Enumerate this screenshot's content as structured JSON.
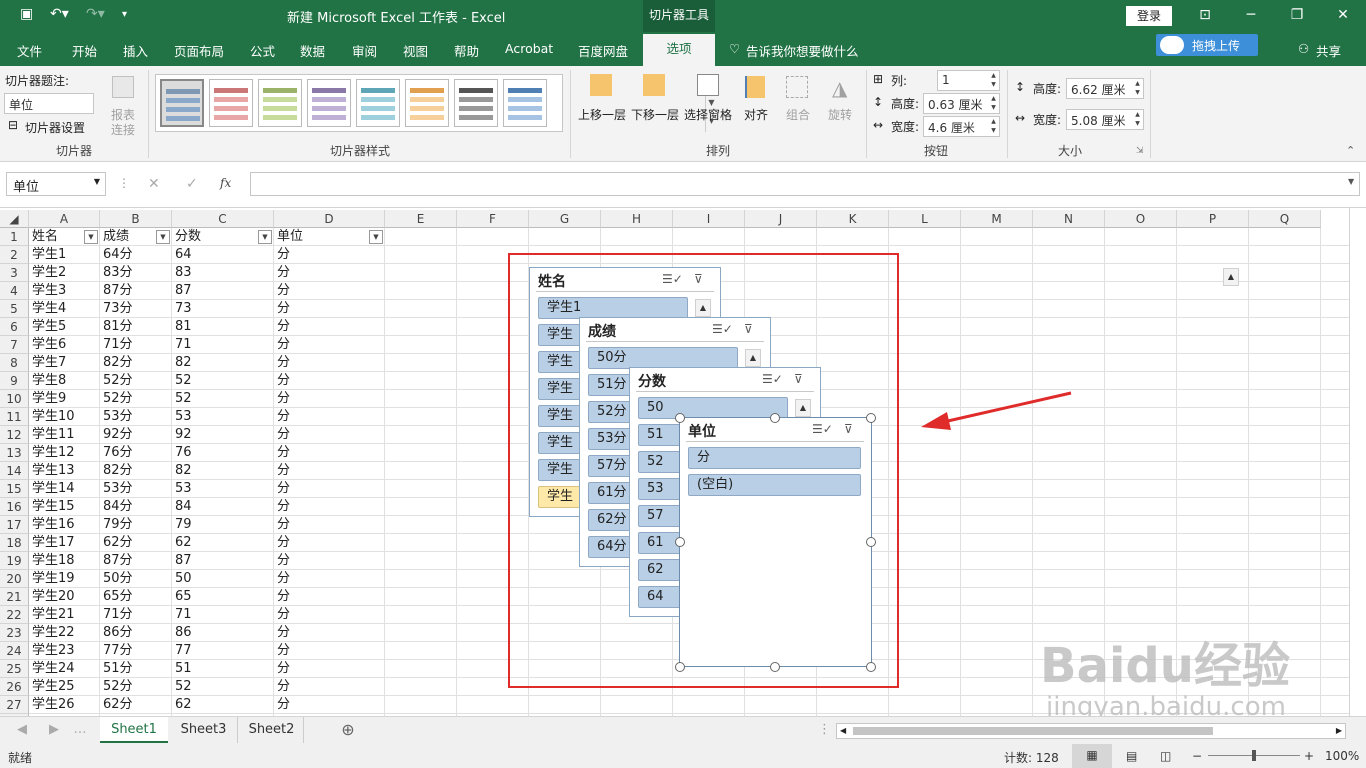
{
  "window": {
    "title": "新建 Microsoft Excel 工作表  -  Excel",
    "context_tools": "切片器工具",
    "login": "登录",
    "upload": "拖拽上传"
  },
  "tabs": [
    "文件",
    "开始",
    "插入",
    "页面布局",
    "公式",
    "数据",
    "审阅",
    "视图",
    "帮助",
    "Acrobat",
    "百度网盘",
    "选项"
  ],
  "tell_me": "告诉我你想要做什么",
  "share": "共享",
  "ribbon": {
    "caption_label": "切片器题注:",
    "caption_value": "单位",
    "settings_label": "切片器设置",
    "report_conn_1": "报表",
    "report_conn_2": "连接",
    "group_slicer": "切片器",
    "group_styles": "切片器样式",
    "bring_forward": "上移一层",
    "send_backward": "下移一层",
    "selection_pane": "选择窗格",
    "align": "对齐",
    "group": "组合",
    "rotate": "旋转",
    "group_arrange": "排列",
    "columns_label": "列:",
    "columns_value": "1",
    "btn_height_label": "高度:",
    "btn_height_value": "0.63 厘米",
    "btn_width_label": "宽度:",
    "btn_width_value": "4.6 厘米",
    "group_buttons": "按钮",
    "size_height_label": "高度:",
    "size_height_value": "6.62 厘米",
    "size_width_label": "宽度:",
    "size_width_value": "5.08 厘米",
    "group_size": "大小"
  },
  "formula_bar": {
    "name_box": "单位",
    "fx": "fx",
    "content": ""
  },
  "columns": [
    "A",
    "B",
    "C",
    "D",
    "E",
    "F",
    "G",
    "H",
    "I",
    "J",
    "K",
    "L",
    "M",
    "N",
    "O",
    "P",
    "Q"
  ],
  "headers": [
    "姓名",
    "成绩",
    "分数",
    "单位"
  ],
  "rows": [
    [
      "学生1",
      "64分",
      "64",
      "分"
    ],
    [
      "学生2",
      "83分",
      "83",
      "分"
    ],
    [
      "学生3",
      "87分",
      "87",
      "分"
    ],
    [
      "学生4",
      "73分",
      "73",
      "分"
    ],
    [
      "学生5",
      "81分",
      "81",
      "分"
    ],
    [
      "学生6",
      "71分",
      "71",
      "分"
    ],
    [
      "学生7",
      "82分",
      "82",
      "分"
    ],
    [
      "学生8",
      "52分",
      "52",
      "分"
    ],
    [
      "学生9",
      "52分",
      "52",
      "分"
    ],
    [
      "学生10",
      "53分",
      "53",
      "分"
    ],
    [
      "学生11",
      "92分",
      "92",
      "分"
    ],
    [
      "学生12",
      "76分",
      "76",
      "分"
    ],
    [
      "学生13",
      "82分",
      "82",
      "分"
    ],
    [
      "学生14",
      "53分",
      "53",
      "分"
    ],
    [
      "学生15",
      "84分",
      "84",
      "分"
    ],
    [
      "学生16",
      "79分",
      "79",
      "分"
    ],
    [
      "学生17",
      "62分",
      "62",
      "分"
    ],
    [
      "学生18",
      "87分",
      "87",
      "分"
    ],
    [
      "学生19",
      "50分",
      "50",
      "分"
    ],
    [
      "学生20",
      "65分",
      "65",
      "分"
    ],
    [
      "学生21",
      "71分",
      "71",
      "分"
    ],
    [
      "学生22",
      "86分",
      "86",
      "分"
    ],
    [
      "学生23",
      "77分",
      "77",
      "分"
    ],
    [
      "学生24",
      "51分",
      "51",
      "分"
    ],
    [
      "学生25",
      "52分",
      "52",
      "分"
    ],
    [
      "学生26",
      "62分",
      "62",
      "分"
    ]
  ],
  "slicers": [
    {
      "title": "姓名",
      "items": [
        "学生1",
        "学生",
        "学生",
        "学生",
        "学生",
        "学生",
        "学生",
        "学生"
      ]
    },
    {
      "title": "成绩",
      "items": [
        "50分",
        "51分",
        "52分",
        "53分",
        "57分",
        "61分",
        "62分",
        "64分"
      ]
    },
    {
      "title": "分数",
      "items": [
        "50",
        "51",
        "52",
        "53",
        "57",
        "61",
        "62",
        "64"
      ]
    },
    {
      "title": "单位",
      "items": [
        "分",
        "(空白)"
      ]
    }
  ],
  "sheets": [
    "Sheet1",
    "Sheet3",
    "Sheet2"
  ],
  "status": {
    "ready": "就绪",
    "count": "计数: 128",
    "zoom": "100%"
  },
  "watermark": {
    "main": "Baidu经验",
    "sub": "jingyan.baidu.com"
  },
  "colors": {
    "excel_green": "#217346",
    "annotation_red": "#e02b2b",
    "slicer_item": "#b9cfe6"
  }
}
